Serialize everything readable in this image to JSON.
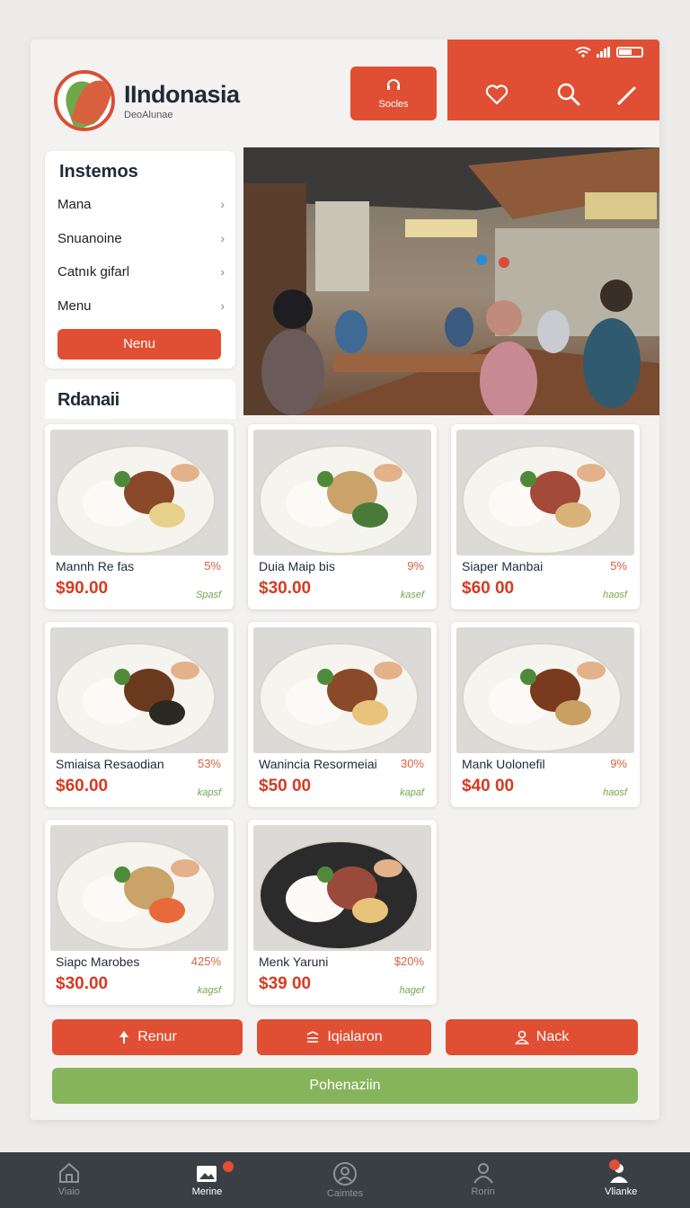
{
  "header": {
    "brand_title": "IIndonasia",
    "brand_subtitle": "DeoAlunae",
    "socles_label": "Socles"
  },
  "sidebar": {
    "title": "Instemos",
    "items": [
      {
        "label": "Mana"
      },
      {
        "label": "Snuanoine"
      },
      {
        "label": "Catnık gifarl"
      },
      {
        "label": "Menu"
      }
    ],
    "button_label": "Nenu"
  },
  "section": {
    "title": "Rdanaii"
  },
  "menu_items": [
    {
      "name": "Mannh Re fas",
      "pct": "5%",
      "price": "$90.00",
      "tag": "Spasf"
    },
    {
      "name": "Duia Maip bis",
      "pct": "9%",
      "price": "$30.00",
      "tag": "kasef"
    },
    {
      "name": "Siaper Manbai",
      "pct": "5%",
      "price": "$60 00",
      "tag": "haosf"
    },
    {
      "name": "Smiaisa Resaodian",
      "pct": "53%",
      "price": "$60.00",
      "tag": "kapsf"
    },
    {
      "name": "Wanincia Resormeiai",
      "pct": "30%",
      "price": "$50 00",
      "tag": "kapaf"
    },
    {
      "name": "Mank Uolonefil",
      "pct": "9%",
      "price": "$40 00",
      "tag": "haosf"
    },
    {
      "name": "Siapc Marobes",
      "pct": "425%",
      "price": "$30.00",
      "tag": "kagsf"
    },
    {
      "name": "Menk Yaruni",
      "pct": "$20%",
      "price": "$39 00",
      "tag": "hagef"
    }
  ],
  "actions": {
    "renur": "Renur",
    "iqialaron": "Iqialaron",
    "nack": "Nack",
    "green": "Pohenaziin"
  },
  "bottom_nav": [
    {
      "label": "Viaio"
    },
    {
      "label": "Merine"
    },
    {
      "label": "Caimtes"
    },
    {
      "label": "Rorin"
    },
    {
      "label": "Vlianke"
    }
  ],
  "colors": {
    "accent": "#e04f33",
    "price": "#d63b22",
    "green": "#86b45c",
    "nav_bg": "#3a3f46"
  }
}
